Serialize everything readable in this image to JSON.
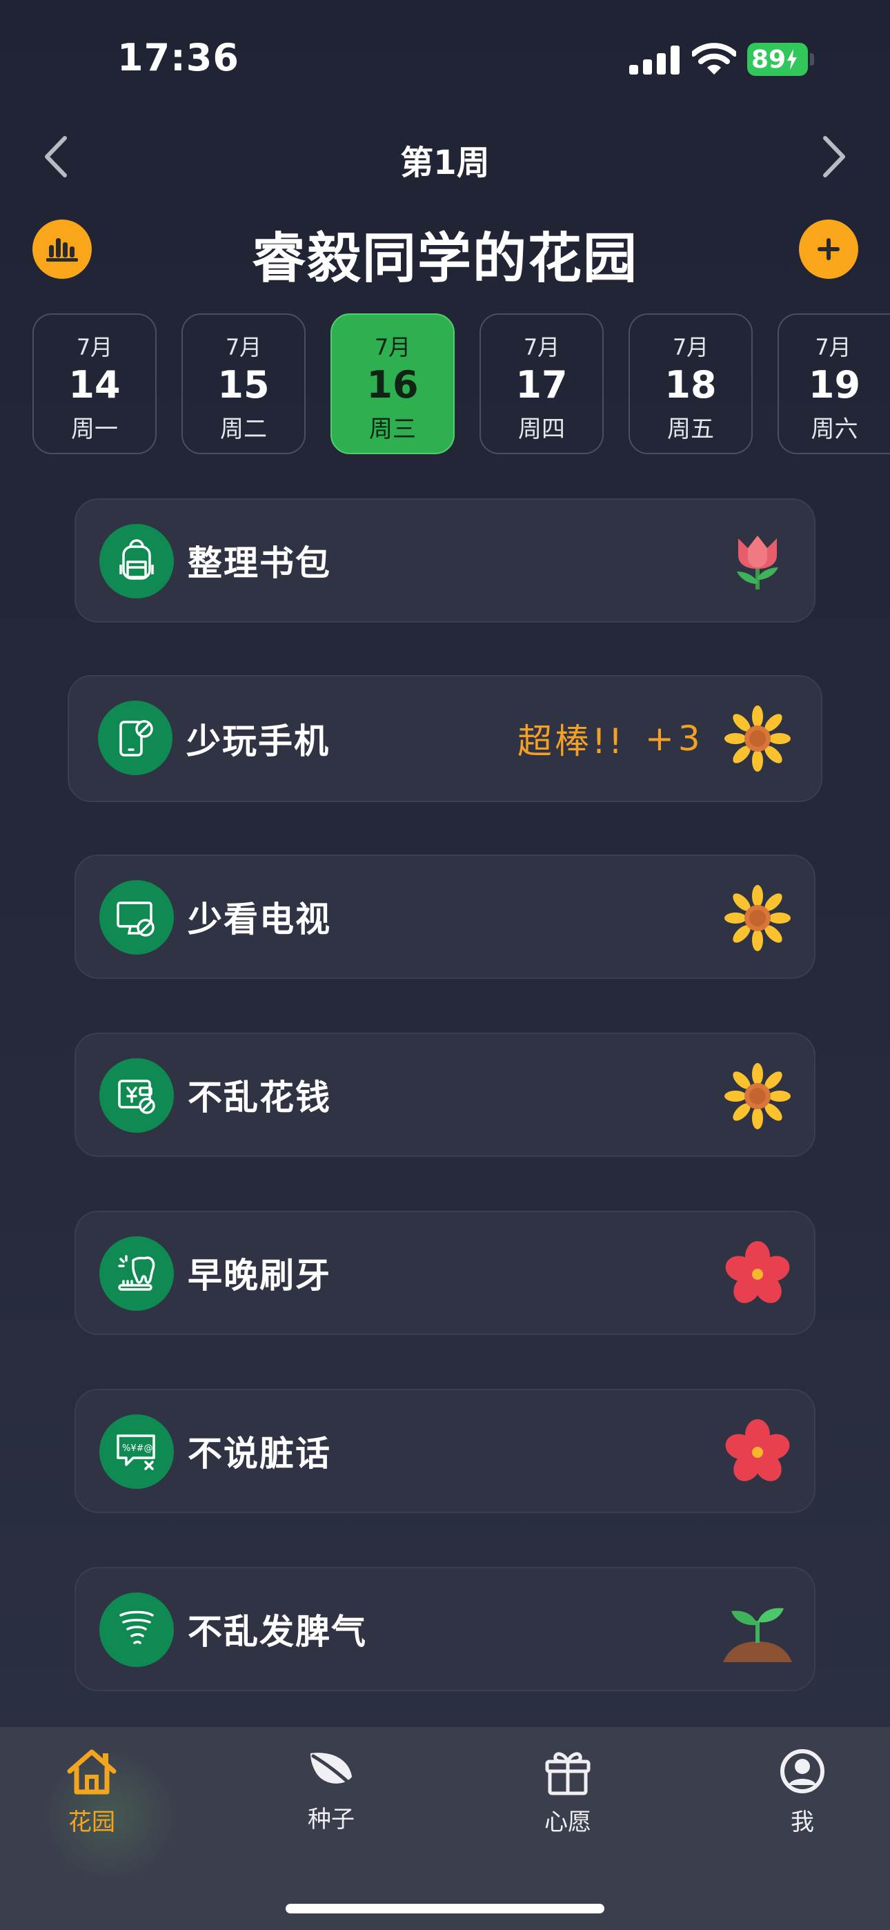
{
  "status": {
    "time": "17:36",
    "battery": "89"
  },
  "header": {
    "week_label": "第1周",
    "title": "睿毅同学的花园"
  },
  "days": [
    {
      "month": "7月",
      "day": "14",
      "weekday": "周一",
      "selected": false
    },
    {
      "month": "7月",
      "day": "15",
      "weekday": "周二",
      "selected": false
    },
    {
      "month": "7月",
      "day": "16",
      "weekday": "周三",
      "selected": true
    },
    {
      "month": "7月",
      "day": "17",
      "weekday": "周四",
      "selected": false
    },
    {
      "month": "7月",
      "day": "18",
      "weekday": "周五",
      "selected": false
    },
    {
      "month": "7月",
      "day": "19",
      "weekday": "周六",
      "selected": false
    }
  ],
  "tasks": [
    {
      "label": "整理书包",
      "icon": "backpack-icon",
      "flower": "tulip-icon"
    },
    {
      "label": "少玩手机",
      "icon": "no-phone-icon",
      "flower": "sunflower-icon",
      "praise": "超棒!!",
      "points": "+3"
    },
    {
      "label": "少看电视",
      "icon": "no-tv-icon",
      "flower": "sunflower-icon"
    },
    {
      "label": "不乱花钱",
      "icon": "no-spending-icon",
      "flower": "sunflower-icon"
    },
    {
      "label": "早晚刷牙",
      "icon": "toothbrush-icon",
      "flower": "red-flower-icon"
    },
    {
      "label": "不说脏话",
      "icon": "no-swearing-icon",
      "flower": "red-flower-icon"
    },
    {
      "label": "不乱发脾气",
      "icon": "tornado-icon",
      "flower": "sprout-icon"
    }
  ],
  "tabs": [
    {
      "label": "花园",
      "icon": "home-icon",
      "active": true
    },
    {
      "label": "种子",
      "icon": "leaf-icon",
      "active": false
    },
    {
      "label": "心愿",
      "icon": "gift-icon",
      "active": false
    },
    {
      "label": "我",
      "icon": "profile-icon",
      "active": false
    }
  ],
  "colors": {
    "accent": "#f9a61a",
    "selected_day": "#2fb050",
    "icon_bg": "#0e8a52",
    "praise": "#f2a026"
  }
}
